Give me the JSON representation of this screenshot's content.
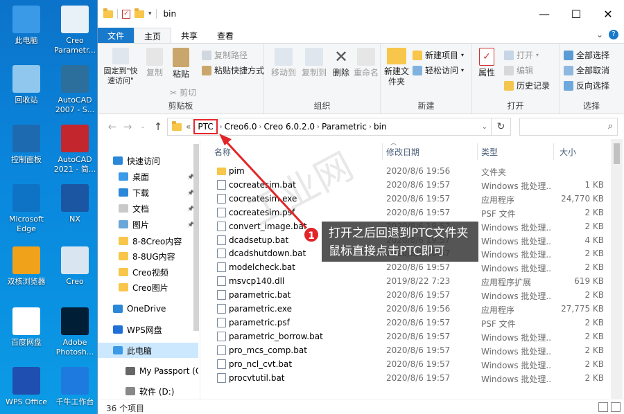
{
  "desktop": {
    "icons": [
      {
        "label": "此电脑",
        "color": "#3a9ae8"
      },
      {
        "label": "Creo Parametr...",
        "color": "#e8f0f8"
      },
      {
        "label": "回收站",
        "color": "#8fc7ee"
      },
      {
        "label": "AutoCAD 2007 - S...",
        "color": "#2c6e9c"
      },
      {
        "label": "控制面板",
        "color": "#1e6ab0"
      },
      {
        "label": "AutoCAD 2021 - 简...",
        "color": "#c4262e"
      },
      {
        "label": "Microsoft Edge",
        "color": "#0f73c5"
      },
      {
        "label": "NX",
        "color": "#1b56a3"
      },
      {
        "label": "双核浏览器",
        "color": "#f0a21a"
      },
      {
        "label": "Creo",
        "color": "#d9e6f2"
      },
      {
        "label": "百度网盘",
        "color": "#ffffff"
      },
      {
        "label": "Adobe Photosh...",
        "color": "#001e36"
      },
      {
        "label": "WPS Office",
        "color": "#1f4fb0"
      },
      {
        "label": "千牛工作台",
        "color": "#1f7ae0"
      }
    ]
  },
  "window": {
    "title": "bin",
    "controls": [
      "—",
      "☐",
      "✕"
    ]
  },
  "tabs": {
    "file": "文件",
    "home": "主页",
    "share": "共享",
    "view": "查看"
  },
  "ribbon": {
    "clipboard": {
      "pin": "固定到\"快速访问\"",
      "copy": "复制",
      "paste": "粘贴",
      "copy_path": "复制路径",
      "paste_shortcut": "粘贴快捷方式",
      "cut": "剪切",
      "label": "剪贴板"
    },
    "organize": {
      "move_to": "移动到",
      "copy_to": "复制到",
      "delete": "删除",
      "rename": "重命名",
      "label": "组织"
    },
    "new": {
      "new_folder": "新建文件夹",
      "new_item": "新建项目",
      "easy_access": "轻松访问",
      "label": "新建"
    },
    "open": {
      "properties": "属性",
      "open": "打开",
      "edit": "编辑",
      "history": "历史记录",
      "label": "打开"
    },
    "select": {
      "select_all": "全部选择",
      "select_none": "全部取消",
      "invert": "反向选择",
      "label": "选择"
    }
  },
  "address": {
    "prefix": "«",
    "crumbs": [
      "PTC",
      "Creo6.0",
      "Creo 6.0.2.0",
      "Parametric",
      "bin"
    ]
  },
  "navpane": {
    "items": [
      {
        "label": "快速访问",
        "icon": "star-icon",
        "color": "#2b88d8",
        "pinned": false
      },
      {
        "label": "桌面",
        "icon": "desktop-icon",
        "color": "#3a9ae8",
        "pinned": true
      },
      {
        "label": "下载",
        "icon": "download-icon",
        "color": "#2b88d8",
        "pinned": true
      },
      {
        "label": "文档",
        "icon": "document-icon",
        "color": "#c9c9c9",
        "pinned": true
      },
      {
        "label": "图片",
        "icon": "picture-icon",
        "color": "#6aa7d8",
        "pinned": true
      },
      {
        "label": "8-8Creo内容",
        "icon": "folder-icon",
        "color": "#f7c64a",
        "pinned": false
      },
      {
        "label": "8-8UG内容",
        "icon": "folder-icon",
        "color": "#f7c64a",
        "pinned": false
      },
      {
        "label": "Creo视频",
        "icon": "folder-icon",
        "color": "#f7c64a",
        "pinned": false
      },
      {
        "label": "Creo图片",
        "icon": "folder-icon",
        "color": "#f7c64a",
        "pinned": false
      },
      {
        "label": "OneDrive",
        "icon": "cloud-icon",
        "color": "#2b88d8",
        "pinned": false
      },
      {
        "label": "WPS网盘",
        "icon": "wps-cloud-icon",
        "color": "#1f6fd6",
        "pinned": false
      },
      {
        "label": "此电脑",
        "icon": "computer-icon",
        "color": "#3a9ae8",
        "pinned": false
      },
      {
        "label": "My Passport (G:",
        "icon": "drive-icon",
        "color": "#666666",
        "pinned": false
      },
      {
        "label": "软件 (D:)",
        "icon": "drive-icon",
        "color": "#888888",
        "pinned": false
      }
    ]
  },
  "columns": {
    "name": "名称",
    "date": "修改日期",
    "type": "类型",
    "size": "大小"
  },
  "files": [
    {
      "name": "pim",
      "date": "2020/8/6 19:56",
      "type": "文件夹",
      "size": "",
      "folder": true
    },
    {
      "name": "cocreatesim.bat",
      "date": "2020/8/6 19:57",
      "type": "Windows 批处理...",
      "size": "1 KB",
      "folder": false
    },
    {
      "name": "cocreatesim.exe",
      "date": "2020/8/6 19:57",
      "type": "应用程序",
      "size": "24,770 KB",
      "folder": false
    },
    {
      "name": "cocreatesim.psf",
      "date": "2020/8/6 19:57",
      "type": "PSF 文件",
      "size": "2 KB",
      "folder": false
    },
    {
      "name": "convert_image.bat",
      "date": "2020/8/6 19:57",
      "type": "Windows 批处理...",
      "size": "2 KB",
      "folder": false
    },
    {
      "name": "dcadsetup.bat",
      "date": "2020/8/6 19:57",
      "type": "Windows 批处理...",
      "size": "4 KB",
      "folder": false
    },
    {
      "name": "dcadshutdown.bat",
      "date": "2020/8/6 19:57",
      "type": "Windows 批处理...",
      "size": "2 KB",
      "folder": false
    },
    {
      "name": "modelcheck.bat",
      "date": "2020/8/6 19:57",
      "type": "Windows 批处理...",
      "size": "2 KB",
      "folder": false
    },
    {
      "name": "msvcp140.dll",
      "date": "2019/8/22 7:23",
      "type": "应用程序扩展",
      "size": "619 KB",
      "folder": false
    },
    {
      "name": "parametric.bat",
      "date": "2020/8/6 19:57",
      "type": "Windows 批处理...",
      "size": "2 KB",
      "folder": false
    },
    {
      "name": "parametric.exe",
      "date": "2020/8/6 19:56",
      "type": "应用程序",
      "size": "27,775 KB",
      "folder": false
    },
    {
      "name": "parametric.psf",
      "date": "2020/8/6 19:57",
      "type": "PSF 文件",
      "size": "2 KB",
      "folder": false
    },
    {
      "name": "parametric_borrow.bat",
      "date": "2020/8/6 19:57",
      "type": "Windows 批处理...",
      "size": "2 KB",
      "folder": false
    },
    {
      "name": "pro_mcs_comp.bat",
      "date": "2020/8/6 19:57",
      "type": "Windows 批处理...",
      "size": "2 KB",
      "folder": false
    },
    {
      "name": "pro_ncl_cvt.bat",
      "date": "2020/8/6 19:57",
      "type": "Windows 批处理...",
      "size": "2 KB",
      "folder": false
    },
    {
      "name": "procvtutil.bat",
      "date": "2020/8/6 19:57",
      "type": "Windows 批处理...",
      "size": "2 KB",
      "folder": false
    }
  ],
  "status": {
    "count": "36 个项目"
  },
  "annotation": {
    "badge": "1",
    "line1": "打开之后回退到PTC文件夹",
    "line2": "鼠标直接点击PTC即可",
    "color": "#e22528"
  },
  "watermark": "工业网"
}
